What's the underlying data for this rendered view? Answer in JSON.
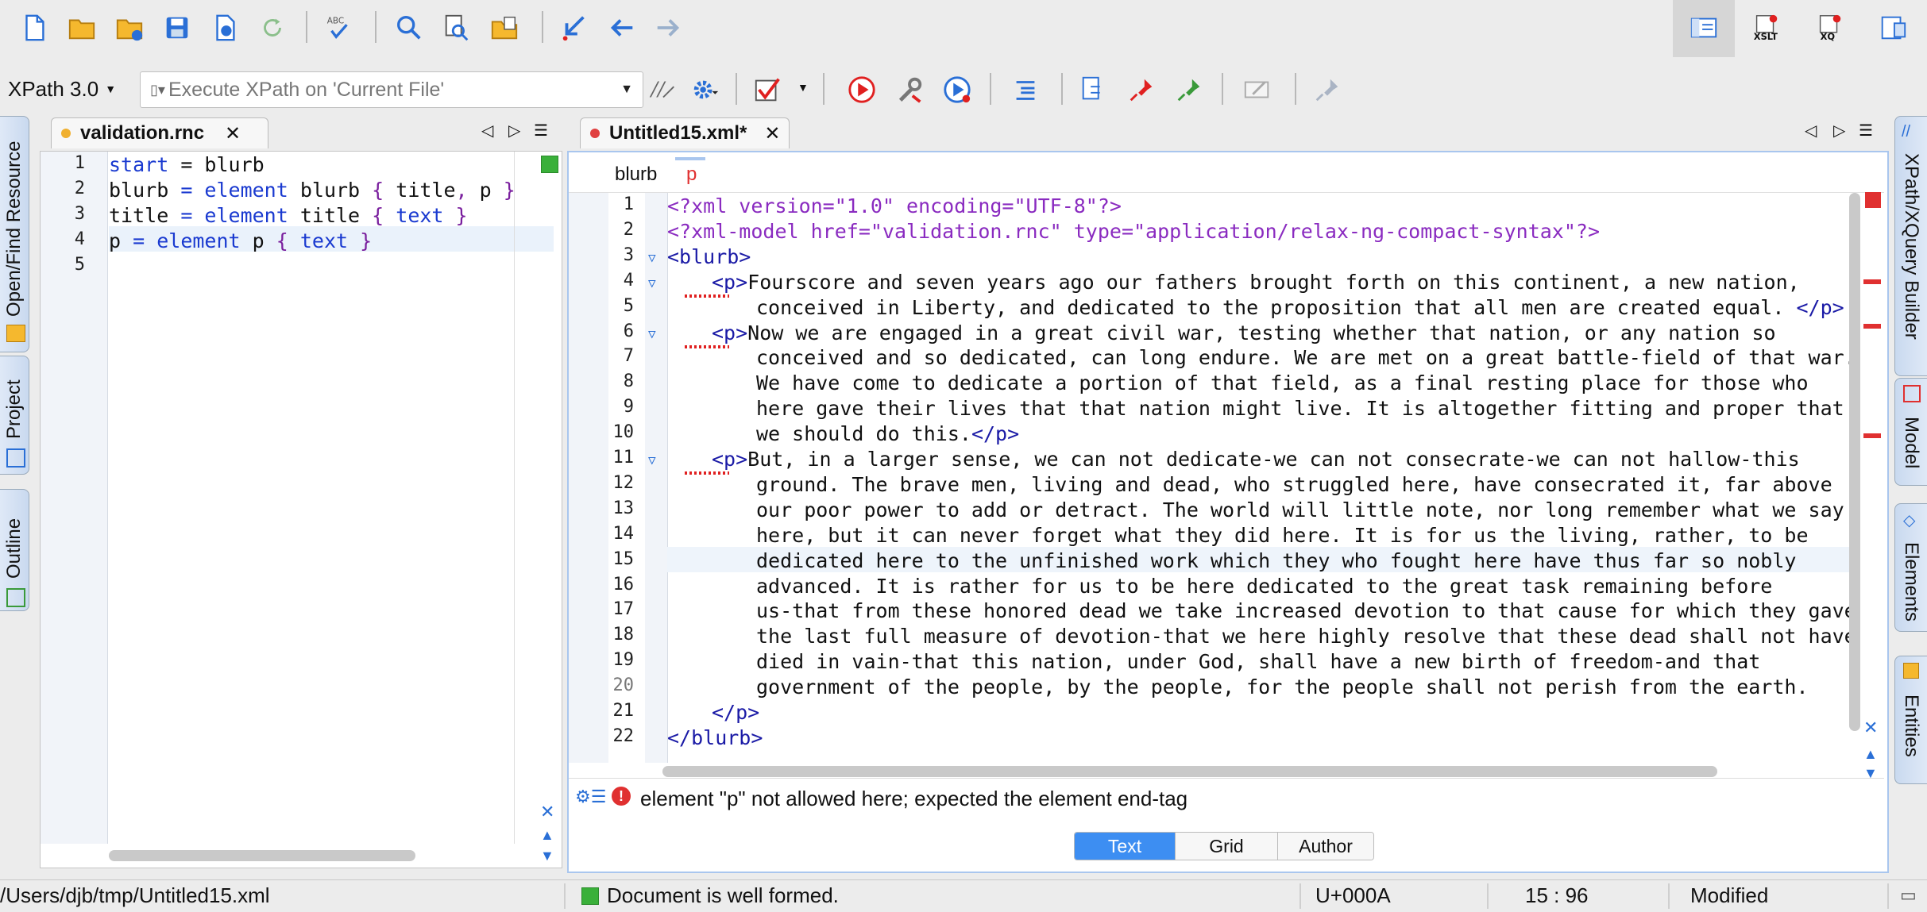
{
  "xpath": {
    "version": "XPath 3.0",
    "placeholder": "Execute XPath on  'Current File'"
  },
  "left_editor": {
    "tab_name": "validation.rnc",
    "lines": [
      {
        "n": "1",
        "parts": [
          [
            "kw",
            "start"
          ],
          [
            "txt",
            " = "
          ],
          [
            "txt",
            "blurb"
          ]
        ]
      },
      {
        "n": "2",
        "parts": [
          [
            "txt",
            "blurb"
          ],
          [
            "kw",
            " = element "
          ],
          [
            "txt",
            "blurb "
          ],
          [
            "br",
            "{ "
          ],
          [
            "txt",
            "title"
          ],
          [
            "br",
            ", "
          ],
          [
            "txt",
            "p "
          ],
          [
            "br",
            "}"
          ]
        ]
      },
      {
        "n": "3",
        "parts": [
          [
            "txt",
            "title"
          ],
          [
            "kw",
            " = element "
          ],
          [
            "txt",
            "title "
          ],
          [
            "br",
            "{ "
          ],
          [
            "kw",
            "text "
          ],
          [
            "br",
            "}"
          ]
        ]
      },
      {
        "n": "4",
        "parts": [
          [
            "txt",
            "p"
          ],
          [
            "kw",
            " = element "
          ],
          [
            "txt",
            "p "
          ],
          [
            "br",
            "{ "
          ],
          [
            "kw",
            "text "
          ],
          [
            "br",
            "}"
          ]
        ]
      },
      {
        "n": "5",
        "parts": []
      }
    ]
  },
  "right_editor": {
    "tab_name": "Untitled15.xml*",
    "breadcrumb": [
      "blurb",
      "p"
    ],
    "lines": [
      {
        "n": "1",
        "indent": 0,
        "parts": [
          [
            "ctrl",
            "<?xml version=\"1.0\" encoding=\"UTF-8\"?>"
          ]
        ]
      },
      {
        "n": "2",
        "indent": 0,
        "parts": [
          [
            "ctrl",
            "<?xml-model href=\"validation.rnc\" type=\"application/relax-ng-compact-syntax\"?>"
          ]
        ]
      },
      {
        "n": "3",
        "indent": 0,
        "parts": [
          [
            "tag",
            "<blurb>"
          ]
        ]
      },
      {
        "n": "4",
        "indent": 1,
        "parts": [
          [
            "tag",
            "<p>"
          ],
          [
            "txt",
            "Fourscore and seven years ago our fathers brought forth on this continent, a new nation,"
          ]
        ]
      },
      {
        "n": "5",
        "indent": 2,
        "parts": [
          [
            "txt",
            "conceived in Liberty, and dedicated to the proposition that all men are created equal. "
          ],
          [
            "tag",
            "</p>"
          ]
        ]
      },
      {
        "n": "6",
        "indent": 1,
        "parts": [
          [
            "tag",
            "<p>"
          ],
          [
            "txt",
            "Now we are engaged in a great civil war, testing whether that nation, or any nation so"
          ]
        ]
      },
      {
        "n": "7",
        "indent": 2,
        "parts": [
          [
            "txt",
            "conceived and so dedicated, can long endure. We are met on a great battle-field of that war."
          ]
        ]
      },
      {
        "n": "8",
        "indent": 2,
        "parts": [
          [
            "txt",
            "We have come to dedicate a portion of that field, as a final resting place for those who"
          ]
        ]
      },
      {
        "n": "9",
        "indent": 2,
        "parts": [
          [
            "txt",
            "here gave their lives that that nation might live. It is altogether fitting and proper that"
          ]
        ]
      },
      {
        "n": "10",
        "indent": 2,
        "parts": [
          [
            "txt",
            "we should do this."
          ],
          [
            "tag",
            "</p>"
          ]
        ]
      },
      {
        "n": "11",
        "indent": 1,
        "parts": [
          [
            "tag",
            "<p>"
          ],
          [
            "txt",
            "But, in a larger sense, we can not dedicate-we can not consecrate-we can not hallow-this"
          ]
        ]
      },
      {
        "n": "12",
        "indent": 2,
        "parts": [
          [
            "txt",
            "ground. The brave men, living and dead, who struggled here, have consecrated it, far above"
          ]
        ]
      },
      {
        "n": "13",
        "indent": 2,
        "parts": [
          [
            "txt",
            "our poor power to add or detract. The world will little note, nor long remember what we say"
          ]
        ]
      },
      {
        "n": "14",
        "indent": 2,
        "parts": [
          [
            "txt",
            "here, but it can never forget what they did here. It is for us the living, rather, to be"
          ]
        ]
      },
      {
        "n": "15",
        "indent": 2,
        "parts": [
          [
            "txt",
            "dedicated here to the unfinished work which they who fought here have thus far so nobly"
          ]
        ]
      },
      {
        "n": "16",
        "indent": 2,
        "parts": [
          [
            "txt",
            "advanced. It is rather for us to be here dedicated to the great task remaining before"
          ]
        ]
      },
      {
        "n": "17",
        "indent": 2,
        "parts": [
          [
            "txt",
            "us-that from these honored dead we take increased devotion to that cause for which they gave"
          ]
        ]
      },
      {
        "n": "18",
        "indent": 2,
        "parts": [
          [
            "txt",
            "the last full measure of devotion-that we here highly resolve that these dead shall not have"
          ]
        ]
      },
      {
        "n": "19",
        "indent": 2,
        "parts": [
          [
            "txt",
            "died in vain-that this nation, under God, shall have a new birth of freedom-and that"
          ]
        ]
      },
      {
        "n": "20",
        "indent": 2,
        "parts": [
          [
            "txt",
            "government of the people, by the people, for the people shall not perish from the earth."
          ]
        ]
      },
      {
        "n": "21",
        "indent": 1,
        "parts": [
          [
            "tag",
            "</p>"
          ]
        ]
      },
      {
        "n": "22",
        "indent": 0,
        "parts": [
          [
            "tag",
            "</blurb>"
          ]
        ]
      }
    ],
    "error_message": "element \"p\" not allowed here; expected the element end-tag",
    "view_tabs": [
      "Text",
      "Grid",
      "Author"
    ]
  },
  "left_side_tabs": [
    "Open/Find Resource",
    "Project",
    "Outline"
  ],
  "right_side_tabs": [
    "XPath/XQuery Builder",
    "Model",
    "Elements",
    "Entities"
  ],
  "toolbar_labels": {
    "xslt": "XSLT",
    "xq": "XQ",
    "abc": "ABC"
  },
  "status": {
    "path": "/Users/djb/tmp/Untitled15.xml",
    "wellformed": "Document is well formed.",
    "unicode": "U+000A",
    "position": "15 : 96",
    "state": "Modified"
  }
}
